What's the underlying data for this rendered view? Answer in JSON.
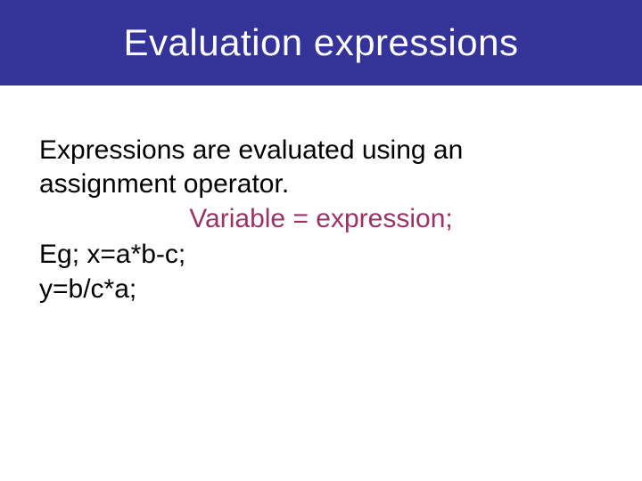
{
  "title": "Evaluation expressions",
  "body": {
    "line1": "Expressions are evaluated using an assignment operator.",
    "syntax": "Variable = expression;",
    "eg1": "Eg; x=a*b-c;",
    "eg2": "y=b/c*a;"
  },
  "colors": {
    "title_bg": "#333399",
    "accent": "#993366"
  }
}
